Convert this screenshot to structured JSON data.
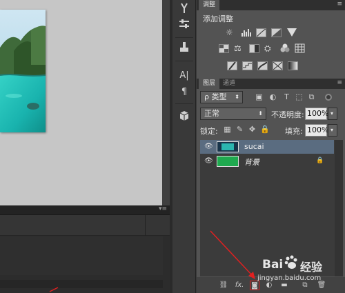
{
  "adjustments_panel": {
    "tab_label": "调整",
    "title": "添加调整"
  },
  "layers_panel": {
    "tabs": [
      "图层",
      "通道"
    ],
    "filter": {
      "label": "ρ 类型"
    },
    "blend_mode": {
      "value": "正常"
    },
    "opacity": {
      "label": "不透明度:",
      "value": "100%"
    },
    "lock": {
      "label": "锁定:"
    },
    "fill": {
      "label": "填充:",
      "value": "100%"
    },
    "layers": [
      {
        "name": "sucai",
        "selected": true,
        "visible": true
      },
      {
        "name": "背景",
        "selected": false,
        "visible": true,
        "locked": true
      }
    ],
    "bottom_icons": [
      "link-icon",
      "fx-icon",
      "mask-icon",
      "adjustment-icon",
      "group-icon",
      "new-layer-icon",
      "trash-icon"
    ],
    "fx_label": "fx."
  },
  "tool_strip": {
    "icons": [
      "brush-presets-icon",
      "properties-icon",
      "clone-source-icon",
      "character-icon",
      "paragraph-icon",
      "3d-icon"
    ],
    "text_glyphs": {
      "character": "A|",
      "paragraph": "¶"
    }
  },
  "watermark": {
    "brand": "Bai",
    "brand2": "经验",
    "url": "jingyan.baidu.com"
  },
  "colors": {
    "panel_bg": "#535353",
    "selected_layer": "#5a6c80",
    "background_layer_fill": "#1fa94f",
    "annotation_arrow": "#e02020"
  }
}
